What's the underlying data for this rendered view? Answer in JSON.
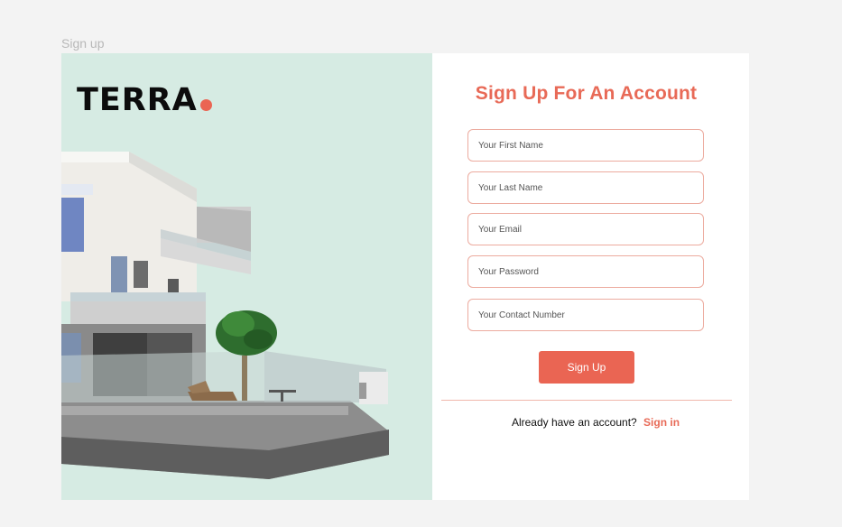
{
  "frame": {
    "label": "Sign up"
  },
  "brand": {
    "name": "TERRA",
    "accent": "#ea6553"
  },
  "form": {
    "title": "Sign Up For An Account",
    "fields": [
      {
        "placeholder": "Your First Name",
        "value": ""
      },
      {
        "placeholder": "Your Last Name",
        "value": ""
      },
      {
        "placeholder": "Your Email",
        "value": ""
      },
      {
        "placeholder": "Your Password",
        "value": ""
      },
      {
        "placeholder": "Your Contact Number",
        "value": ""
      }
    ],
    "submit_label": "Sign Up",
    "signin_prompt": "Already have an account?",
    "signin_link": "Sign in"
  },
  "colors": {
    "left_panel_bg": "#d6ebe3",
    "accent": "#ea6553",
    "title": "#e86a57",
    "field_border": "#ecab9f"
  }
}
